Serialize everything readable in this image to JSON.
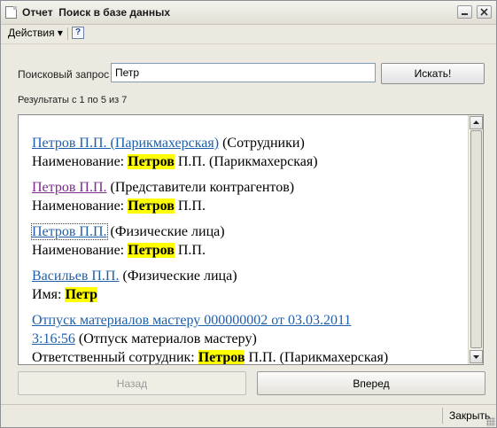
{
  "window": {
    "title": "Отчет  Поиск в базе данных",
    "minimize_icon": "minimize-icon",
    "maximize_icon": "close-icon"
  },
  "menubar": {
    "actions_label": "Действия ▾",
    "help_label": "?"
  },
  "search": {
    "label": "Поисковый запрос",
    "value": "Петр",
    "button_label": "Искать!"
  },
  "results": {
    "count_text": "Результаты с 1 по 5 из 7",
    "items": [
      {
        "link": "Петров П.П. (Парикмахерская)",
        "type": " (Сотрудники)",
        "field_label": "Наименование: ",
        "highlight": "Петров",
        "rest": " П.П. (Парикмахерская)"
      },
      {
        "link": "Петров П.П.",
        "type": " (Представители контрагентов)",
        "field_label": "Наименование: ",
        "highlight": "Петров",
        "rest": " П.П."
      },
      {
        "link": "Петров П.П.",
        "type": " (Физические лица)",
        "field_label": "Наименование: ",
        "highlight": "Петров",
        "rest": " П.П."
      },
      {
        "link": "Васильев П.П.",
        "type": " (Физические лица)",
        "field_label": "Имя: ",
        "highlight": "Петр",
        "rest": ""
      },
      {
        "link_line1": "Отпуск материалов мастеру 000000002 от 03.03.2011",
        "link_line2": "3:16:56",
        "type": " (Отпуск материалов мастеру)",
        "field_label": "Ответственный сотрудник: ",
        "highlight": "Петров",
        "rest": " П.П. (Парикмахерская)"
      }
    ]
  },
  "navigation": {
    "back_label": "Назад",
    "next_label": "Вперед"
  },
  "footer": {
    "close_label": "Закрыть"
  },
  "colors": {
    "link": "#1f5fa8",
    "visited_link": "#7a2a8a",
    "highlight": "#ffff00",
    "window_bg": "#eceae0"
  }
}
